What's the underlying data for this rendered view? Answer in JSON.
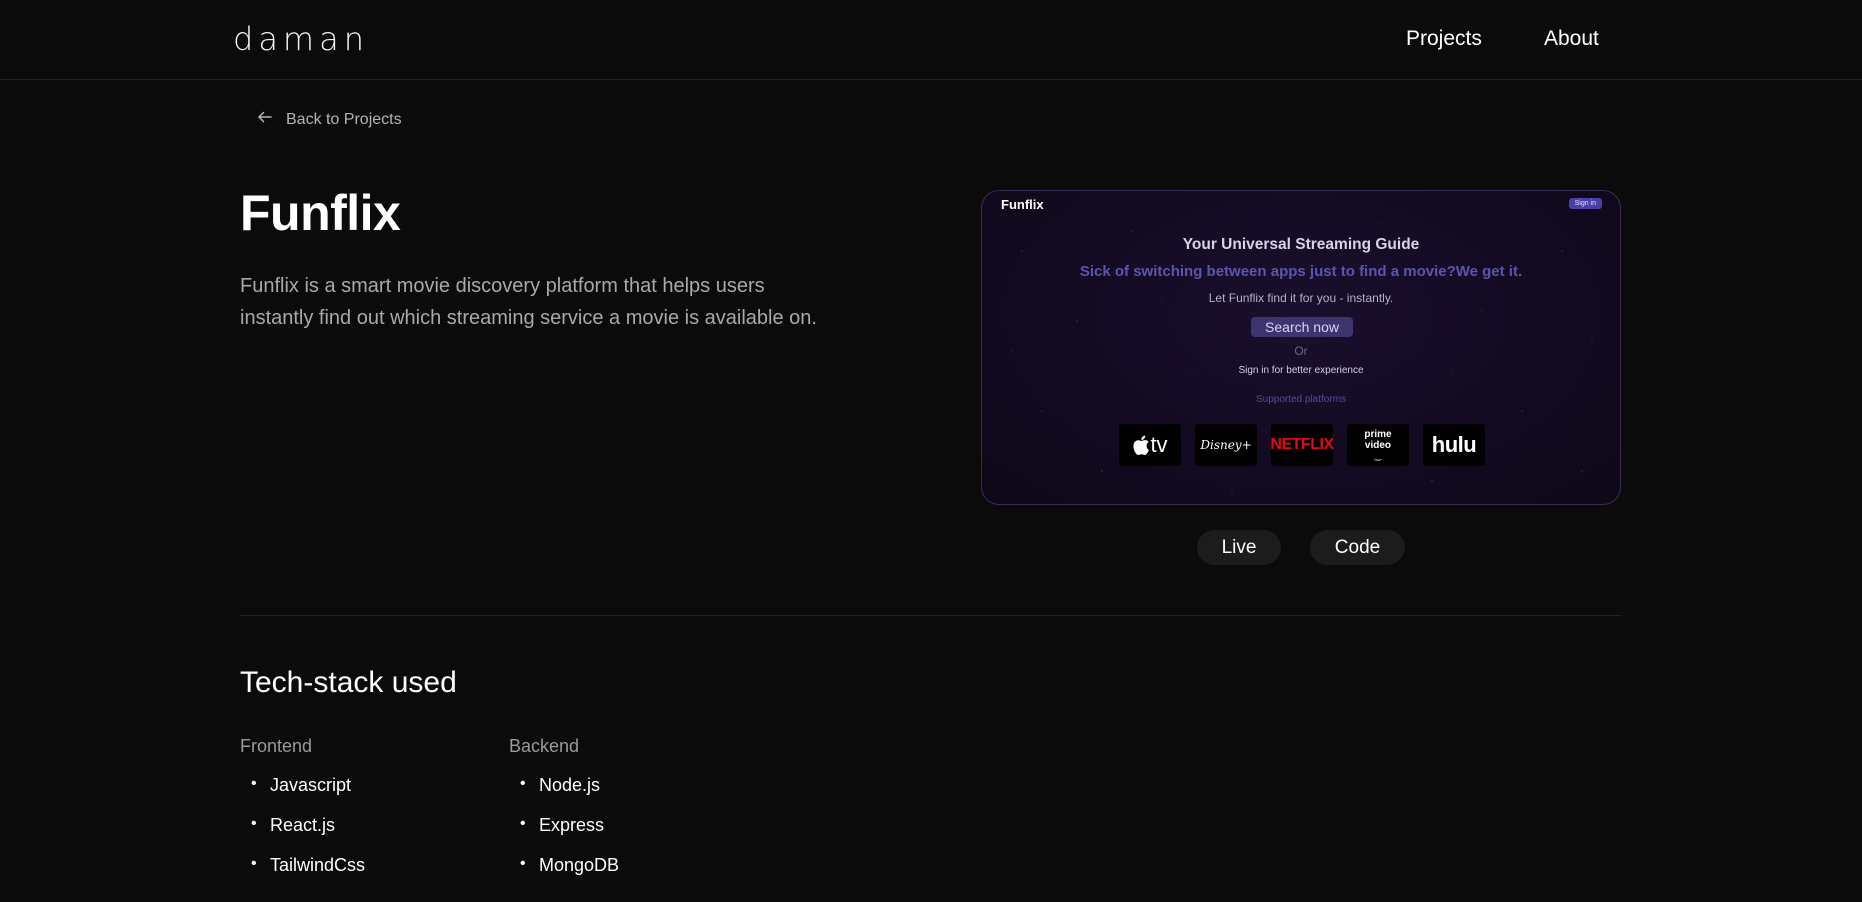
{
  "nav": {
    "logo": "daman",
    "links": [
      "Projects",
      "About"
    ]
  },
  "back_link": "Back to Projects",
  "project": {
    "title": "Funflix",
    "description": "Funflix is a smart movie discovery platform that helps users instantly find out which streaming service a movie is available on."
  },
  "preview": {
    "brand": "Funflix",
    "sign_in": "Sign in",
    "heading": "Your Universal Streaming Guide",
    "tagline": "Sick of switching between apps just to find a movie?We get it.",
    "subtext": "Let Funflix find it for you - instantly.",
    "search_button": "Search now",
    "or": "Or",
    "sign_in_note": "Sign in for better experience",
    "supported": "Supported platforms",
    "platform_logos": [
      "apple-tv-logo",
      "disney-plus-logo",
      "netflix-logo",
      "prime-video-logo",
      "hulu-logo"
    ],
    "logo_text": {
      "apple": "tv",
      "disney": "Disney+",
      "netflix": "NETFLIX",
      "prime_line1": "prime",
      "prime_line2": "video",
      "hulu": "hulu"
    }
  },
  "actions": {
    "live": "Live",
    "code": "Code"
  },
  "tech_stack": {
    "title": "Tech-stack used",
    "frontend": {
      "label": "Frontend",
      "items": [
        "Javascript",
        "React.js",
        "TailwindCss"
      ]
    },
    "backend": {
      "label": "Backend",
      "items": [
        "Node.js",
        "Express",
        "MongoDB"
      ]
    }
  },
  "colors": {
    "background": "#0b0b0b",
    "accent_purple": "#5c55b0",
    "netflix_red": "#e50914"
  }
}
